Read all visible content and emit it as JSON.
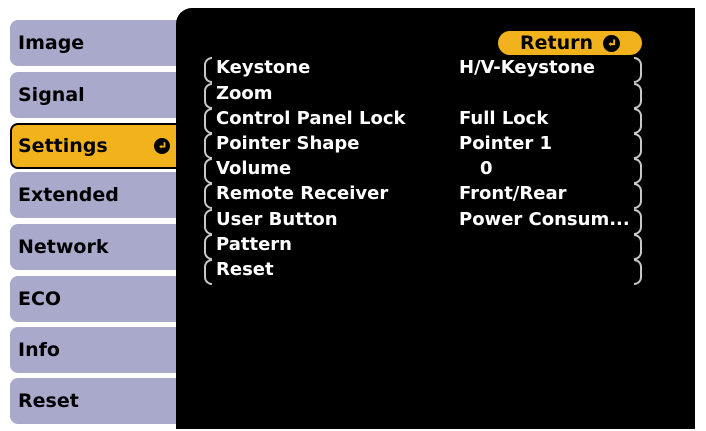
{
  "tabs": [
    {
      "label": "Image"
    },
    {
      "label": "Signal"
    },
    {
      "label": "Settings"
    },
    {
      "label": "Extended"
    },
    {
      "label": "Network"
    },
    {
      "label": "ECO"
    },
    {
      "label": "Info"
    },
    {
      "label": "Reset"
    }
  ],
  "active_tab": "Settings",
  "return_button": {
    "label": "Return"
  },
  "settings_items": [
    {
      "label": "Keystone",
      "value": "H/V-Keystone"
    },
    {
      "label": "Zoom",
      "value": ""
    },
    {
      "label": "Control Panel Lock",
      "value": "Full Lock"
    },
    {
      "label": "Pointer Shape",
      "value": "Pointer 1"
    },
    {
      "label": "Volume",
      "value": "0"
    },
    {
      "label": "Remote Receiver",
      "value": "Front/Rear"
    },
    {
      "label": "User Button",
      "value": "Power Consum..."
    },
    {
      "label": "Pattern",
      "value": ""
    },
    {
      "label": "Reset",
      "value": ""
    }
  ],
  "colors": {
    "tab": "#a9a9cc",
    "accent": "#f2b21c",
    "panel": "#000000",
    "text_on_panel": "#ffffff"
  },
  "icons": {
    "active_tab": "enter-icon",
    "return": "enter-icon"
  }
}
